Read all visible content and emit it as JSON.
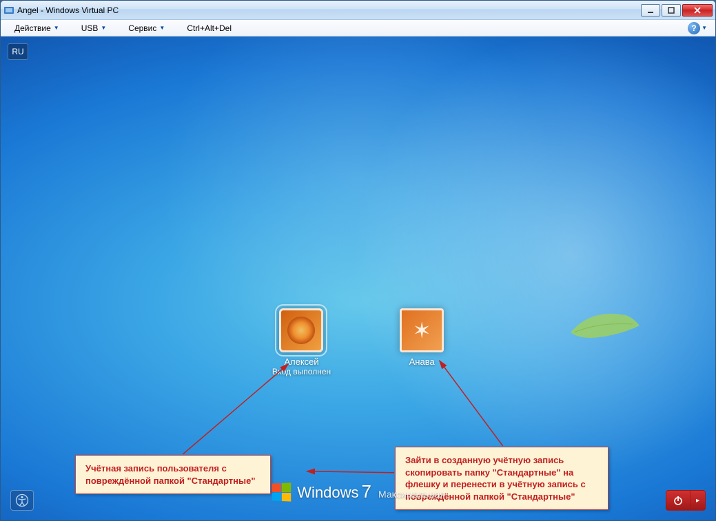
{
  "window": {
    "title": "Angel - Windows Virtual PC"
  },
  "menubar": {
    "items": [
      "Действие",
      "USB",
      "Сервис",
      "Ctrl+Alt+Del"
    ]
  },
  "lang": "RU",
  "users": [
    {
      "name": "Алексей",
      "status": "Вход выполнен"
    },
    {
      "name": "Анава",
      "status": ""
    }
  ],
  "brand": {
    "name": "Windows",
    "version": "7",
    "edition": "Максимальная"
  },
  "callouts": {
    "left": "Учётная запись пользователя с повреждённой папкой \"Стандартные\"",
    "right": "Зайти в созданную учётную запись скопировать папку \"Стандартные\" на флешку  и перенести в учётную запись с повреждённой папкой \"Стандартные\""
  }
}
